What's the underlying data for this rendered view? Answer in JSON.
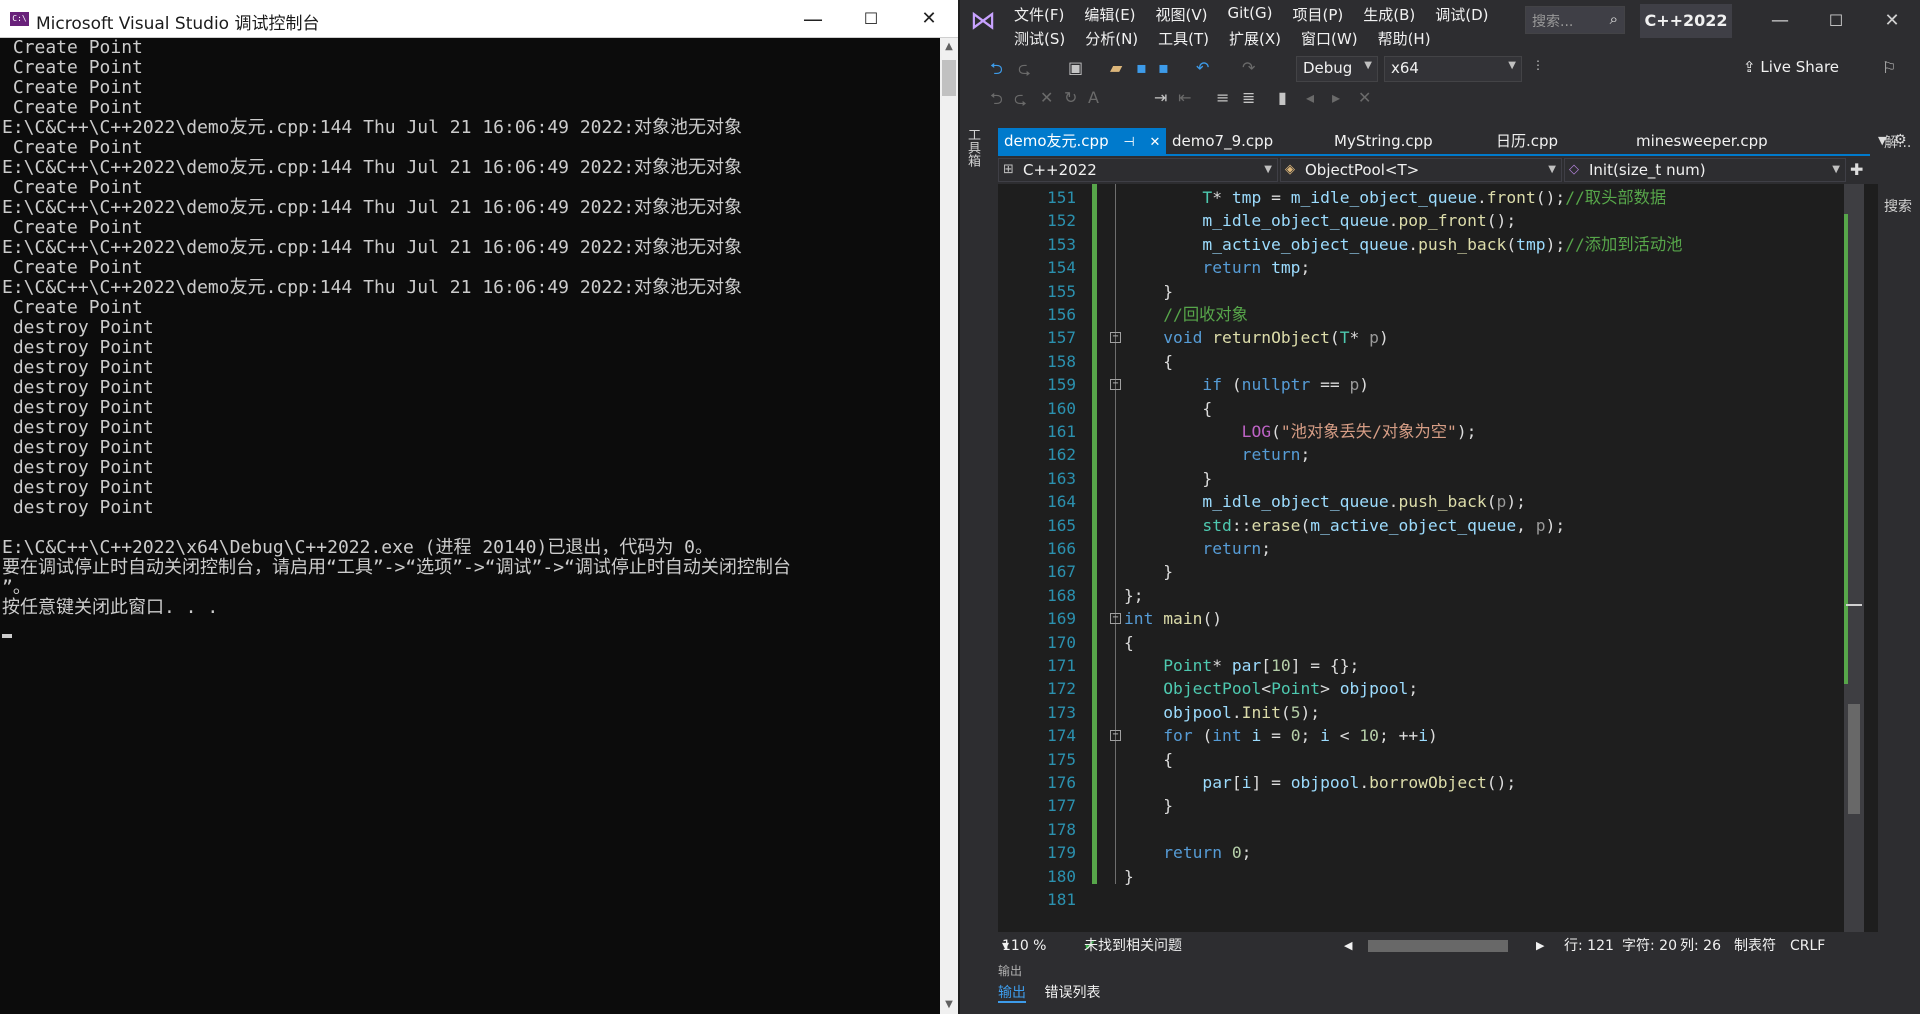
{
  "console": {
    "title": "Microsoft Visual Studio 调试控制台",
    "icon_text": "C:\\",
    "minimize": "—",
    "maximize": "☐",
    "close": "✕",
    "lines": [
      " Create Point",
      " Create Point",
      " Create Point",
      " Create Point",
      "E:\\C&C++\\C++2022\\demo友元.cpp:144 Thu Jul 21 16:06:49 2022:对象池无对象",
      " Create Point",
      "E:\\C&C++\\C++2022\\demo友元.cpp:144 Thu Jul 21 16:06:49 2022:对象池无对象",
      " Create Point",
      "E:\\C&C++\\C++2022\\demo友元.cpp:144 Thu Jul 21 16:06:49 2022:对象池无对象",
      " Create Point",
      "E:\\C&C++\\C++2022\\demo友元.cpp:144 Thu Jul 21 16:06:49 2022:对象池无对象",
      " Create Point",
      "E:\\C&C++\\C++2022\\demo友元.cpp:144 Thu Jul 21 16:06:49 2022:对象池无对象",
      " Create Point",
      " destroy Point",
      " destroy Point",
      " destroy Point",
      " destroy Point",
      " destroy Point",
      " destroy Point",
      " destroy Point",
      " destroy Point",
      " destroy Point",
      " destroy Point",
      "",
      "E:\\C&C++\\C++2022\\x64\\Debug\\C++2022.exe (进程 20140)已退出，代码为 0。",
      "要在调试停止时自动关闭控制台，请启用“工具”->“选项”->“调试”->“调试停止时自动关闭控制台",
      "”。",
      "按任意键关闭此窗口. . ."
    ]
  },
  "vs": {
    "menu_row1": [
      "文件(F)",
      "编辑(E)",
      "视图(V)",
      "Git(G)",
      "项目(P)",
      "生成(B)",
      "调试(D)"
    ],
    "menu_row2": [
      "测试(S)",
      "分析(N)",
      "工具(T)",
      "扩展(X)",
      "窗口(W)",
      "帮助(H)"
    ],
    "search_placeholder": "搜索...",
    "solution_name": "C++2022",
    "config": "Debug",
    "platform": "x64",
    "live_share": "Live Share",
    "left_strip_label": "工具箱",
    "right_strip_labels": [
      "解...",
      "搜索"
    ],
    "tabs": [
      {
        "label": "demo友元.cpp",
        "active": true
      },
      {
        "label": "demo7_9.cpp",
        "active": false
      },
      {
        "label": "MyString.cpp",
        "active": false
      },
      {
        "label": "日历.cpp",
        "active": false
      },
      {
        "label": "minesweeper.cpp",
        "active": false
      }
    ],
    "nav": {
      "project": "C++2022",
      "scope": "ObjectPool<T>",
      "member": "Init(size_t num)"
    },
    "line_numbers": [
      "151",
      "152",
      "153",
      "154",
      "155",
      "156",
      "157",
      "158",
      "159",
      "160",
      "161",
      "162",
      "163",
      "164",
      "165",
      "166",
      "167",
      "168",
      "169",
      "170",
      "171",
      "172",
      "173",
      "174",
      "175",
      "176",
      "177",
      "178",
      "179",
      "180",
      "181"
    ],
    "editor_info": {
      "zoom": "110 %",
      "issues": "未找到相关问题",
      "line": "行: 121",
      "char": "字符: 20",
      "col": "列: 26",
      "tabs": "制表符",
      "eol": "CRLF"
    },
    "bottom_panel": {
      "title": "输出",
      "tabs": [
        "输出",
        "错误列表"
      ]
    }
  }
}
